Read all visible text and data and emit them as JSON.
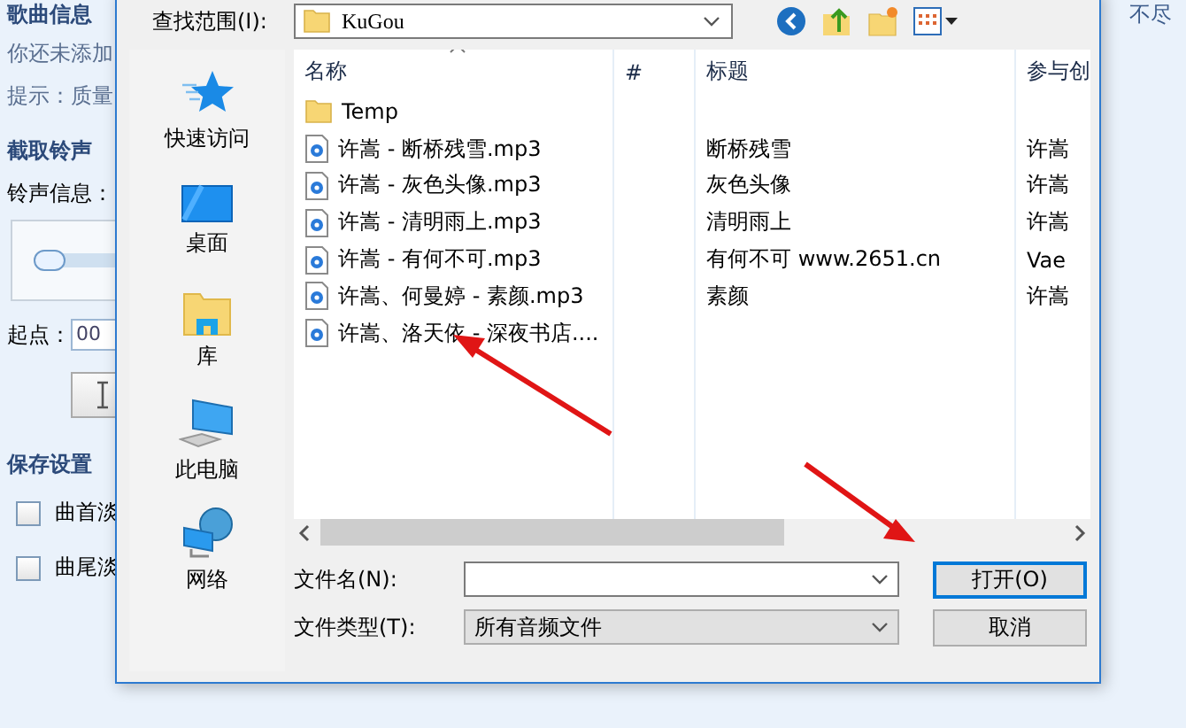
{
  "background_app": {
    "song_info": {
      "title": "歌曲信息",
      "message": "你还未添加",
      "hint": "提示：质量"
    },
    "ringtone": {
      "title": "截取铃声",
      "info_label": "铃声信息：",
      "slider": {
        "level": 0.0
      },
      "start_label": "起点：",
      "start_value": "00"
    },
    "save": {
      "title": "保存设置",
      "options": [
        {
          "label": "曲首淡",
          "checked": false
        },
        {
          "label": "曲尾淡",
          "checked": false
        }
      ]
    },
    "corner_text": "不尽"
  },
  "dialog": {
    "look_in_label": "查找范围(I):",
    "look_in_value": "KuGou",
    "places": [
      {
        "label": "快速访问",
        "kind": "star"
      },
      {
        "label": "桌面",
        "kind": "desktop"
      },
      {
        "label": "库",
        "kind": "library"
      },
      {
        "label": "此电脑",
        "kind": "computer"
      },
      {
        "label": "网络",
        "kind": "network"
      }
    ],
    "columns": [
      "名称",
      "#",
      "标题",
      "参与创"
    ],
    "files": [
      {
        "kind": "folder",
        "name": "Temp"
      },
      {
        "kind": "audio",
        "name": "许嵩 - 断桥残雪.mp3",
        "title": "断桥残雪",
        "artist": "许嵩"
      },
      {
        "kind": "audio",
        "name": "许嵩 - 灰色头像.mp3",
        "title": "灰色头像",
        "artist": "许嵩"
      },
      {
        "kind": "audio",
        "name": "许嵩 - 清明雨上.mp3",
        "title": "清明雨上",
        "artist": "许嵩"
      },
      {
        "kind": "audio",
        "name": "许嵩 - 有何不可.mp3",
        "title": "有何不可 www.2651.cn",
        "artist": "Vae"
      },
      {
        "kind": "audio",
        "name": "许嵩、何曼婷 - 素颜.mp3",
        "title": "素颜",
        "artist": "许嵩"
      },
      {
        "kind": "audio",
        "name": "许嵩、洛天依 - 深夜书店...."
      }
    ],
    "file_name_label": "文件名(N):",
    "file_type_label": "文件类型(T):",
    "file_type_value": "所有音频文件",
    "open_button": "打开(O)",
    "cancel_button": "取消"
  }
}
